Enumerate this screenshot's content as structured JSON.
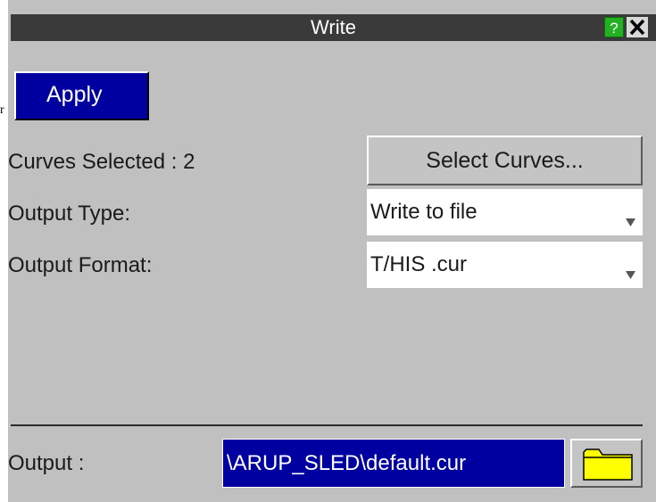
{
  "window": {
    "title": "Write",
    "help_label": "?",
    "stray_text": "r"
  },
  "toolbar": {
    "apply_label": "Apply"
  },
  "curves": {
    "label": "Curves Selected : 2",
    "select_button_label": "Select Curves..."
  },
  "output_type": {
    "label": "Output Type:",
    "value": "Write to file"
  },
  "output_format": {
    "label": "Output Format:",
    "value": "T/HIS .cur"
  },
  "output": {
    "label": "Output :",
    "path": "\\ARUP_SLED\\default.cur"
  },
  "icons": {
    "help": "question-mark-icon",
    "close": "close-x-icon",
    "dropdown": "dropdown-arrow-icon",
    "folder": "folder-icon"
  },
  "colors": {
    "window_bg": "#c0c0c0",
    "titlebar": "#3a3a3a",
    "accent_blue": "#0000a0",
    "help_green": "#23b123",
    "folder_yellow": "#ffff00"
  }
}
